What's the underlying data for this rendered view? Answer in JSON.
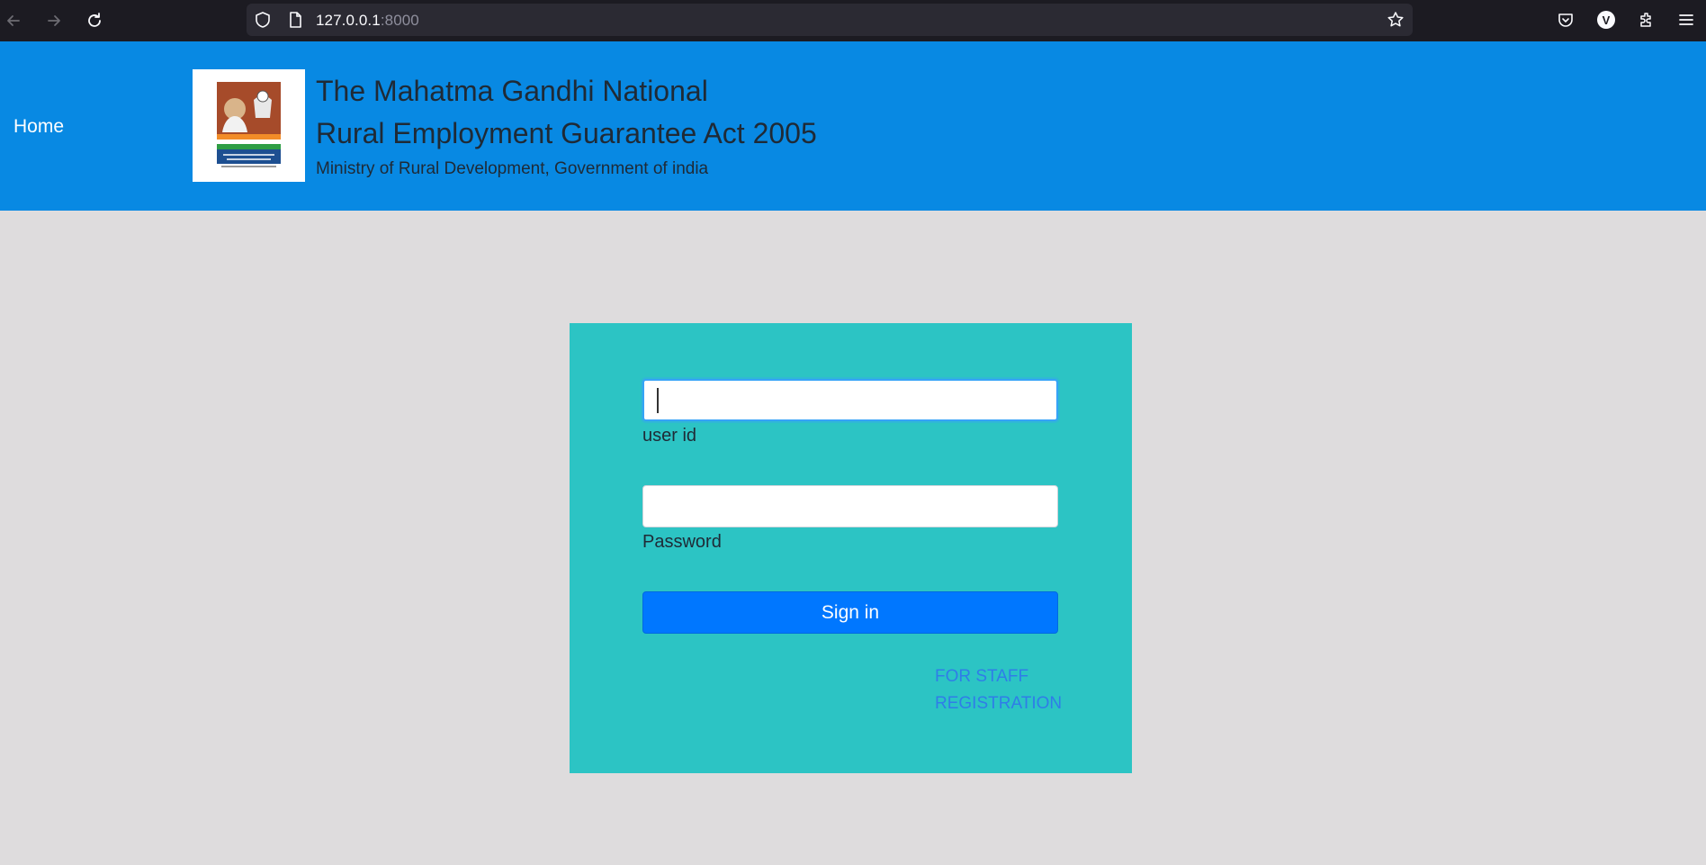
{
  "browser": {
    "url_host": "127.0.0.1",
    "url_port": ":8000",
    "profile_initial": "V"
  },
  "header": {
    "home_label": "Home",
    "title_line1": "The Mahatma Gandhi National",
    "title_line2": "Rural Employment Guarantee Act 2005",
    "subtitle": "Ministry of Rural Development, Government of india"
  },
  "login": {
    "userid_value": "",
    "userid_label": "user id",
    "password_value": "",
    "password_label": "Password",
    "signin_label": "Sign in",
    "staff_link_label": "FOR STAFF REGISTRATION"
  },
  "colors": {
    "header_bg": "#0889e3",
    "card_bg": "#2cc4c4",
    "button_bg": "#0077ff",
    "page_bg": "#dedcdd",
    "link": "#2f7de8"
  }
}
